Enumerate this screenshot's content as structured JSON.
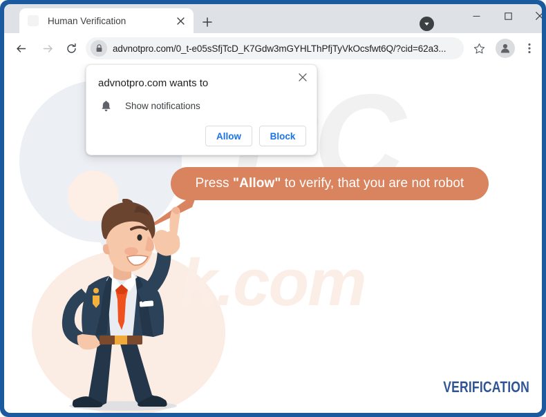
{
  "window": {
    "controls": {
      "download_label": "download-indicator",
      "minimize_label": "Minimize",
      "maximize_label": "Maximize",
      "close_label": "Close"
    }
  },
  "tabstrip": {
    "tabs": [
      {
        "title": "Human Verification",
        "close_label": "Close tab"
      }
    ],
    "new_tab_label": "New tab"
  },
  "toolbar": {
    "back_label": "Back",
    "forward_label": "Forward",
    "reload_label": "Reload this page",
    "url": "advnotpro.com/0_t-e05sSfjTcD_K7Gdw3mGYHLThPfjTyVkOcsfwt6Q/?cid=62a3...",
    "lock_label": "View site information",
    "bookmark_label": "Bookmark this tab",
    "profile_label": "Profile",
    "menu_label": "Customize and control Google Chrome"
  },
  "dialog": {
    "title": "advnotpro.com wants to",
    "permission": "Show notifications",
    "allow_label": "Allow",
    "block_label": "Block",
    "close_label": "Close"
  },
  "page": {
    "bubble_text_before": "Press ",
    "bubble_text_emphasis": "\"Allow\"",
    "bubble_text_after": " to verify, that you are not robot",
    "verification_label": "VERIFICATION",
    "watermark_pc": "PC",
    "watermark_domain": "k.com"
  },
  "colors": {
    "window_frame": "#1b5a9e",
    "bubble": "#d9845f",
    "dialog_action": "#1a73e8",
    "verification": "#2f5596",
    "suit": "#273b4d",
    "tie": "#f0521f"
  }
}
